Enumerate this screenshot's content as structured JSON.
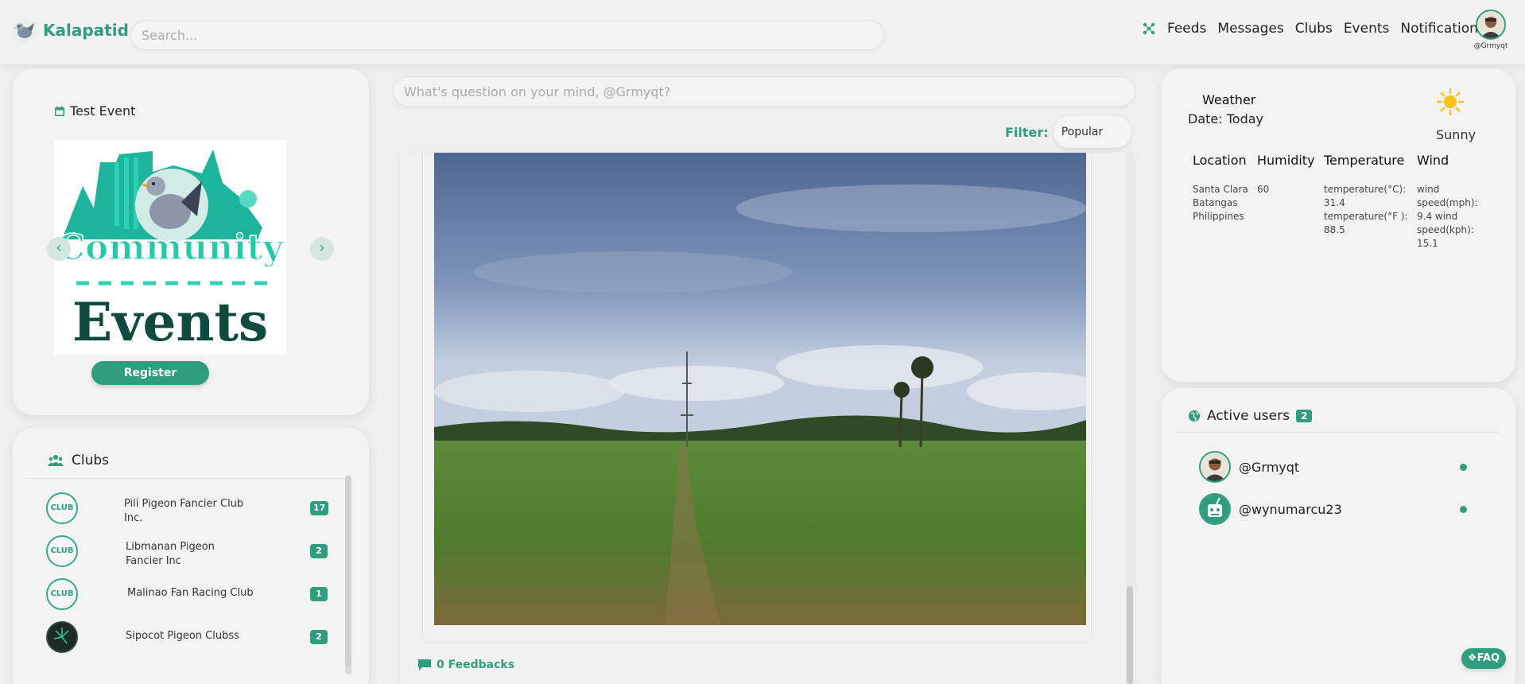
{
  "app": {
    "brand": "Kalapatid"
  },
  "search": {
    "placeholder": "Search..."
  },
  "nav": {
    "items": [
      "Feeds",
      "Messages",
      "Clubs",
      "Events",
      "Notifications"
    ]
  },
  "current_user": {
    "handle": "@Grmyqt"
  },
  "event": {
    "title": "Test Event",
    "image_text": {
      "line1": "Community",
      "line2": "Events"
    },
    "register_label": "Register"
  },
  "clubs": {
    "title": "Clubs",
    "items": [
      {
        "name": "Pili Pigeon Fancier Club Inc.",
        "count": "17",
        "logo": "CLUB"
      },
      {
        "name": "Libmanan Pigeon Fancier Inc",
        "count": "2",
        "logo": "CLUB"
      },
      {
        "name": "Malinao Fan Racing Club",
        "count": "1",
        "logo": "CLUB"
      },
      {
        "name": "Sipocot Pigeon Clubss",
        "count": "2",
        "logo": ""
      }
    ]
  },
  "composer": {
    "placeholder": "What's question on your mind, @Grmyqt?"
  },
  "filter": {
    "label": "Filter:",
    "selected": "Popular"
  },
  "post": {
    "feedback_label": "0 Feedbacks"
  },
  "weather": {
    "title": "Weather",
    "date": "Date: Today",
    "condition": "Sunny",
    "headers": {
      "location": "Location",
      "humidity": "Humidity",
      "temperature": "Temperature",
      "wind": "Wind"
    },
    "location": "Santa Clara Batangas Philippines",
    "humidity": "60",
    "temperature": "temperature(°C): 31.4 temperature(°F ): 88.5",
    "wind": "wind speed(mph): 9.4 wind speed(kph): 15.1"
  },
  "active_users": {
    "title": "Active users",
    "count": "2",
    "users": [
      {
        "handle": "@Grmyqt"
      },
      {
        "handle": "@wynumarcu23"
      }
    ]
  },
  "faq": {
    "label": "FAQ"
  },
  "colors": {
    "accent": "#2f9e7f",
    "background": "#efefef"
  }
}
